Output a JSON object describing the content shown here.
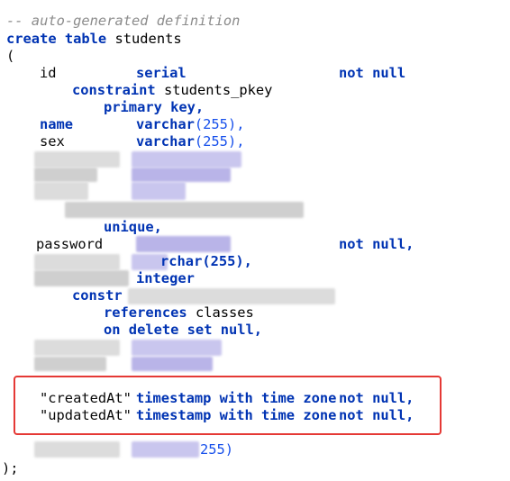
{
  "code": {
    "comment": "-- auto-generated definition",
    "create_kw": "create table",
    "table_name": "students",
    "open_paren": "(",
    "col_id_name": "id",
    "col_id_type": "serial",
    "col_id_null": "not null",
    "constraint_kw": "constraint",
    "constraint_name": "students_pkey",
    "primary_key": "primary key,",
    "col_name_name": "name",
    "col_name_type": "varchar",
    "col_name_size": "(255),",
    "col_sex_name": "sex",
    "col_sex_type": "varchar",
    "col_sex_size": "(255),",
    "unique_kw": "unique,",
    "col_password_name": "password",
    "col_password_null": "not null,",
    "fragment_archar": "rchar(255),",
    "fragment_integer": "integer",
    "constraint2_kw": "constr",
    "references_kw": "references",
    "references_table": "classes",
    "on_delete": "on delete set null,",
    "fragment_status": "status",
    "col_created_name": "\"createdAt\"",
    "col_created_type": "timestamp with time zone",
    "col_created_null": "not null,",
    "col_updated_name": "\"updatedAt\"",
    "col_updated_type": "timestamp with time zone",
    "col_updated_null": "not null,",
    "fragment_255": "255)",
    "close_paren": ");"
  },
  "colors": {
    "keyword": "#0033b3",
    "comment": "#8c8c8c",
    "number": "#1750eb",
    "highlight_border": "#e53935"
  }
}
